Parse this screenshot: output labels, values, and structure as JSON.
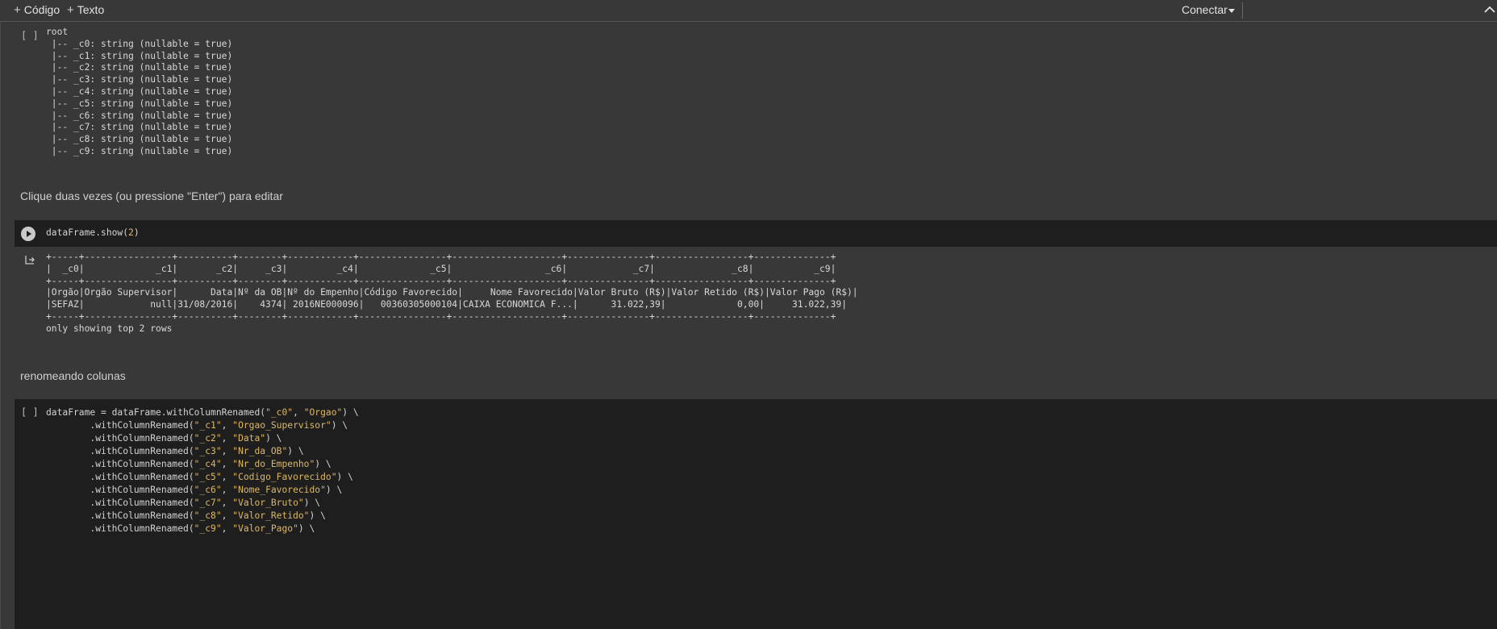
{
  "toolbar": {
    "add_code_label": "Código",
    "add_text_label": "Texto",
    "connect_label": "Conectar"
  },
  "cell1": {
    "bracket": "[ ]",
    "output": "root\n |-- _c0: string (nullable = true)\n |-- _c1: string (nullable = true)\n |-- _c2: string (nullable = true)\n |-- _c3: string (nullable = true)\n |-- _c4: string (nullable = true)\n |-- _c5: string (nullable = true)\n |-- _c6: string (nullable = true)\n |-- _c7: string (nullable = true)\n |-- _c8: string (nullable = true)\n |-- _c9: string (nullable = true)"
  },
  "text_cell1": {
    "text": "Clique duas vezes (ou pressione \"Enter\") para editar"
  },
  "cell2": {
    "code_func": "dataFrame.show(",
    "code_arg": "2",
    "code_end": ")",
    "output": "+-----+----------------+----------+--------+------------+----------------+--------------------+---------------+-----------------+--------------+\n|  _c0|             _c1|       _c2|     _c3|         _c4|             _c5|                 _c6|            _c7|              _c8|           _c9|\n+-----+----------------+----------+--------+------------+----------------+--------------------+---------------+-----------------+--------------+\n|Orgão|Orgão Supervisor|      Data|Nº da OB|Nº do Empenho|Código Favorecido|     Nome Favorecido|Valor Bruto (R$)|Valor Retido (R$)|Valor Pago (R$)|\n|SEFAZ|            null|31/08/2016|    4374| 2016NE000096|   00360305000104|CAIXA ECONOMICA F...|      31.022,39|             0,00|     31.022,39|\n+-----+----------------+----------+--------+------------+----------------+--------------------+---------------+-----------------+--------------+\nonly showing top 2 rows"
  },
  "text_cell2": {
    "text": "renomeando colunas"
  },
  "cell3": {
    "bracket": "[ ]",
    "first_prefix": "dataFrame = dataFrame.withColumnRenamed(",
    "rename_prefix": "        .withColumnRenamed(",
    "renames": [
      {
        "from": "\"_c0\"",
        "to": "\"Orgao\""
      },
      {
        "from": "\"_c1\"",
        "to": "\"Orgao_Supervisor\""
      },
      {
        "from": "\"_c2\"",
        "to": "\"Data\""
      },
      {
        "from": "\"_c3\"",
        "to": "\"Nr_da_OB\""
      },
      {
        "from": "\"_c4\"",
        "to": "\"Nr_do_Empenho\""
      },
      {
        "from": "\"_c5\"",
        "to": "\"Codigo_Favorecido\""
      },
      {
        "from": "\"_c6\"",
        "to": "\"Nome_Favorecido\""
      },
      {
        "from": "\"_c7\"",
        "to": "\"Valor_Bruto\""
      },
      {
        "from": "\"_c8\"",
        "to": "\"Valor_Retido\""
      },
      {
        "from": "\"_c9\"",
        "to": "\"Valor_Pago\""
      }
    ],
    "separator": ", ",
    "line_end": ") \\"
  }
}
